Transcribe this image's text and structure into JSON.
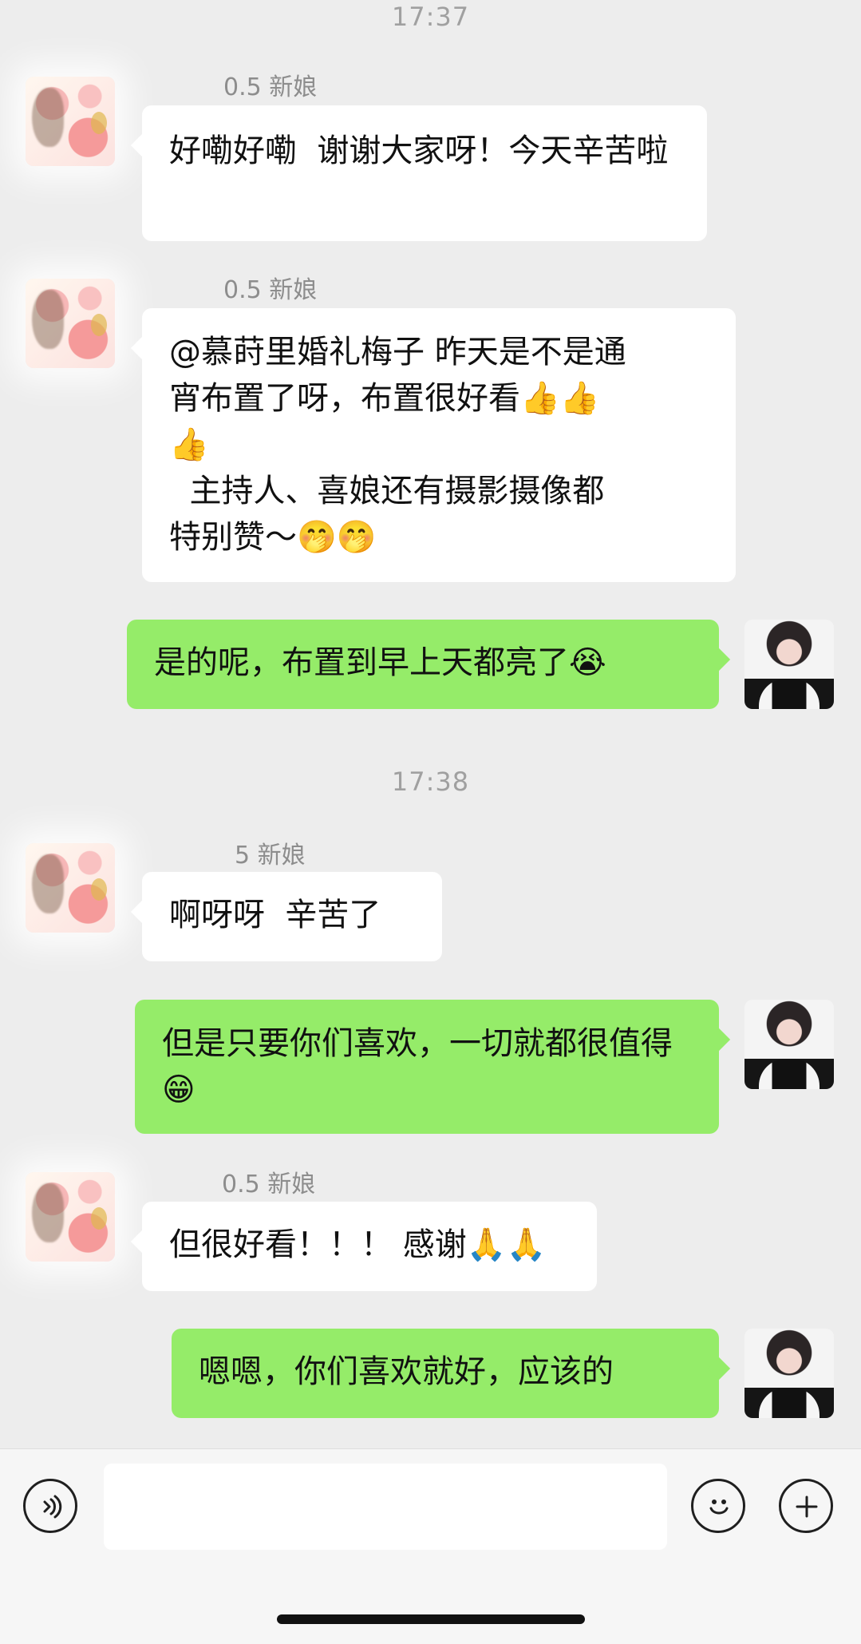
{
  "timestamps": [
    "17:37",
    "17:38"
  ],
  "messages": [
    {
      "sender": "0.5 新娘",
      "text": "好嘞好嘞  谢谢大家呀！今天辛苦啦"
    },
    {
      "sender": "0.5 新娘",
      "lines": [
        "@慕莳里婚礼梅子 昨天是不是通",
        "宵布置了呀，布置很好看👍👍",
        "👍",
        "  主持人、喜娘还有摄影摄像都",
        "特别赞～🤭🤭"
      ]
    },
    {
      "text": "是的呢，布置到早上天都亮了😭"
    },
    {
      "sender": "5 新娘",
      "text": "啊呀呀  辛苦了"
    },
    {
      "text": "但是只要你们喜欢，一切就都很值得😁"
    },
    {
      "sender": "0.5 新娘",
      "text": "但很好看！！！ 感谢🙏🙏"
    },
    {
      "text": "嗯嗯，你们喜欢就好，应该的"
    }
  ],
  "bottom_bar": {
    "icons": [
      "voice-icon",
      "emoji-icon",
      "plus-icon"
    ],
    "input_value": ""
  },
  "colors": {
    "background": "#ededed",
    "incoming_bubble": "#ffffff",
    "outgoing_bubble": "#95ec69",
    "timestamp": "#a0a0a0"
  }
}
